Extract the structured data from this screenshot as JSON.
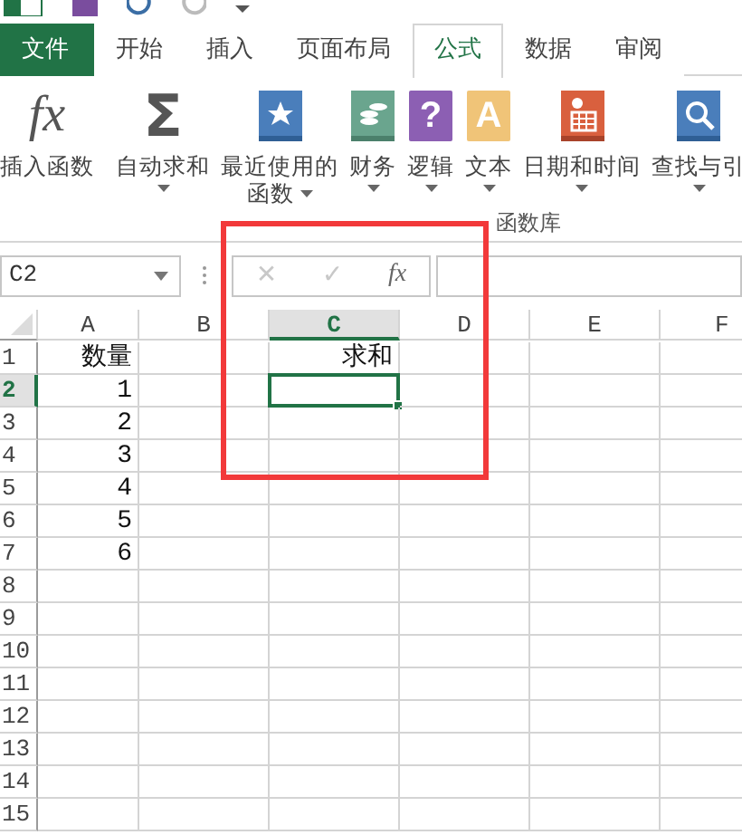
{
  "quick_access": {
    "items": [
      {
        "kind": "excel"
      },
      {
        "kind": "save"
      },
      {
        "kind": "undo"
      },
      {
        "kind": "redo"
      },
      {
        "kind": "customize"
      }
    ]
  },
  "tabs": [
    {
      "label": "文件",
      "kind": "file",
      "selected": false
    },
    {
      "label": "开始",
      "kind": "tab",
      "selected": false
    },
    {
      "label": "插入",
      "kind": "tab",
      "selected": false
    },
    {
      "label": "页面布局",
      "kind": "tab",
      "selected": false
    },
    {
      "label": "公式",
      "kind": "tab",
      "selected": true
    },
    {
      "label": "数据",
      "kind": "tab",
      "selected": false
    },
    {
      "label": "审阅",
      "kind": "tab",
      "selected": false
    }
  ],
  "ribbon": {
    "buttons": [
      {
        "kind": "fx",
        "glyph": "fx",
        "label": "插入函数",
        "dropdown": false
      },
      {
        "kind": "sum",
        "glyph": "Σ",
        "label": "自动求和",
        "dropdown": true
      },
      {
        "kind": "recent",
        "label": "最近使用的",
        "label_line_2": "函数",
        "dropdown": true
      },
      {
        "kind": "finance",
        "label": "财务",
        "dropdown": true
      },
      {
        "kind": "logic",
        "glyph": "?",
        "label": "逻辑",
        "dropdown": true
      },
      {
        "kind": "text",
        "glyph": "A",
        "label": "文本",
        "dropdown": true
      },
      {
        "kind": "datetime",
        "label": "日期和时间",
        "dropdown": true
      },
      {
        "kind": "lookup",
        "label": "查找与引",
        "dropdown": true
      }
    ],
    "group_label": "函数库"
  },
  "formula_bar": {
    "name_box": "C2",
    "cancel": {
      "glyph": "✕",
      "disabled": true
    },
    "enter": {
      "glyph": "✓",
      "disabled": true
    },
    "insert_function": "fx"
  },
  "sheet": {
    "columns": [
      {
        "label": "A",
        "selected": false
      },
      {
        "label": "B",
        "selected": false
      },
      {
        "label": "C",
        "selected": true
      },
      {
        "label": "D",
        "selected": false
      },
      {
        "label": "E",
        "selected": false
      },
      {
        "label": "F",
        "selected": false
      }
    ],
    "rows": [
      {
        "label": "1",
        "selected": false,
        "cells": [
          "数量",
          null,
          "求和"
        ]
      },
      {
        "label": "2",
        "selected": true,
        "cells": [
          "1"
        ]
      },
      {
        "label": "3",
        "selected": false,
        "cells": [
          "2"
        ]
      },
      {
        "label": "4",
        "selected": false,
        "cells": [
          "3"
        ]
      },
      {
        "label": "5",
        "selected": false,
        "cells": [
          "4"
        ]
      },
      {
        "label": "6",
        "selected": false,
        "cells": [
          "5"
        ]
      },
      {
        "label": "7",
        "selected": false,
        "cells": [
          "6"
        ]
      },
      {
        "label": "8",
        "selected": false
      },
      {
        "label": "9",
        "selected": false
      },
      {
        "label": "10",
        "selected": false
      },
      {
        "label": "11",
        "selected": false
      },
      {
        "label": "12",
        "selected": false
      },
      {
        "label": "13",
        "selected": false
      },
      {
        "label": "14",
        "selected": false
      },
      {
        "label": "15",
        "selected": false
      }
    ]
  },
  "annotation": {
    "kind": "highlight-rectangle"
  }
}
